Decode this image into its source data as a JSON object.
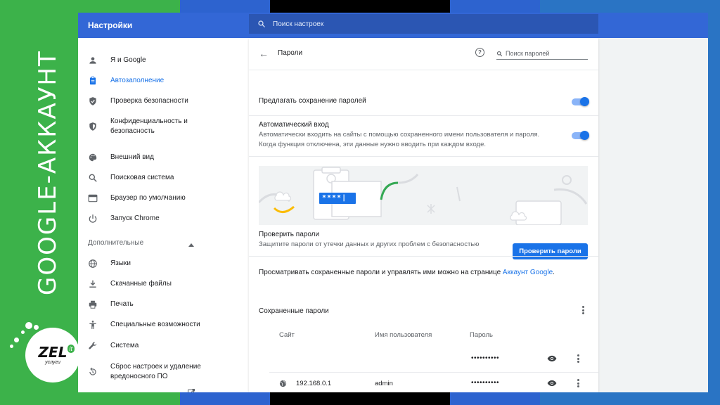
{
  "side_banner": {
    "title": "GOOGLE-АККАУНТ",
    "logo_text": "ZEL",
    "logo_badge": "it",
    "logo_sub": "услуги"
  },
  "header": {
    "title": "Настройки",
    "search_placeholder": "Поиск настроек"
  },
  "sidebar": {
    "items": [
      {
        "label": "Я и Google",
        "icon": "person-icon"
      },
      {
        "label": "Автозаполнение",
        "icon": "clipboard-icon",
        "active": true
      },
      {
        "label": "Проверка безопасности",
        "icon": "shield-icon"
      },
      {
        "label": "Конфиденциальность и",
        "label2": "безопасность",
        "icon": "shield-lock-icon"
      },
      {
        "label": "Внешний вид",
        "icon": "palette-icon"
      },
      {
        "label": "Поисковая система",
        "icon": "search-icon"
      },
      {
        "label": "Браузер по умолчанию",
        "icon": "browser-icon"
      },
      {
        "label": "Запуск Chrome",
        "icon": "power-icon"
      }
    ],
    "advanced_header": "Дополнительные",
    "advanced_items": [
      {
        "label": "Языки",
        "icon": "globe-icon"
      },
      {
        "label": "Скачанные файлы",
        "icon": "download-icon"
      },
      {
        "label": "Печать",
        "icon": "printer-icon"
      },
      {
        "label": "Специальные возможности",
        "icon": "accessibility-icon"
      },
      {
        "label": "Система",
        "icon": "wrench-icon"
      },
      {
        "label": "Сброс настроек и удаление",
        "label2": "вредоносного ПО",
        "icon": "reset-icon"
      }
    ]
  },
  "passwords_page": {
    "title": "Пароли",
    "search_placeholder": "Поиск паролей",
    "offer_save_label": "Предлагать сохранение паролей",
    "offer_save_enabled": true,
    "auto_signin_label": "Автоматический вход",
    "auto_signin_desc1": "Автоматически входить на сайты с помощью сохраненного имени пользователя и пароля.",
    "auto_signin_desc2": "Когда функция отключена, эти данные нужно вводить при каждом входе.",
    "auto_signin_enabled": true,
    "illustration_text": "****|",
    "check_title": "Проверить пароли",
    "check_desc": "Защитите пароли от утечки данных и других проблем с безопасностью",
    "check_button": "Проверить пароли",
    "manage_text": "Просматривать сохраненные пароли и управлять ими можно на странице ",
    "manage_link": "Аккаунт Google",
    "manage_suffix": ".",
    "saved_header": "Сохраненные пароли",
    "columns": {
      "site": "Сайт",
      "username": "Имя пользователя",
      "password": "Пароль"
    },
    "rows": [
      {
        "site": "",
        "username": "",
        "password": "••••••••••"
      },
      {
        "site": "192.168.0.1",
        "username": "admin",
        "password": "••••••••••"
      },
      {
        "site": "",
        "username": "",
        "password": "••••••••••"
      }
    ]
  }
}
